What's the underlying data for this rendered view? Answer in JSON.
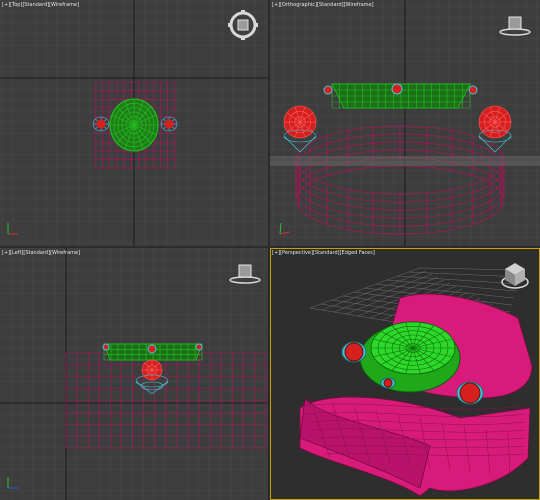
{
  "viewports": {
    "top": {
      "labels": [
        "[+]",
        "[Top]",
        "[Standard]",
        "[Wireframe]"
      ]
    },
    "ortho": {
      "labels": [
        "[+]",
        "[Orthographic]",
        "[Standard]",
        "[Wireframe]"
      ]
    },
    "left": {
      "labels": [
        "[+]",
        "[Left]",
        "[Standard]",
        "[Wireframe]"
      ]
    },
    "persp": {
      "labels": [
        "[+]",
        "[Perspective]",
        "[Standard]",
        "[Edged Faces]"
      ]
    }
  },
  "colors": {
    "background": "#3d3d3d",
    "grid": "#4a4a4a",
    "grid_axis": "#1c1c1c",
    "band": "#b0125a",
    "dome": "#22c41e",
    "gem": "#d62020",
    "bezel": "#3fc8d8",
    "active_border": "#c8a000"
  }
}
